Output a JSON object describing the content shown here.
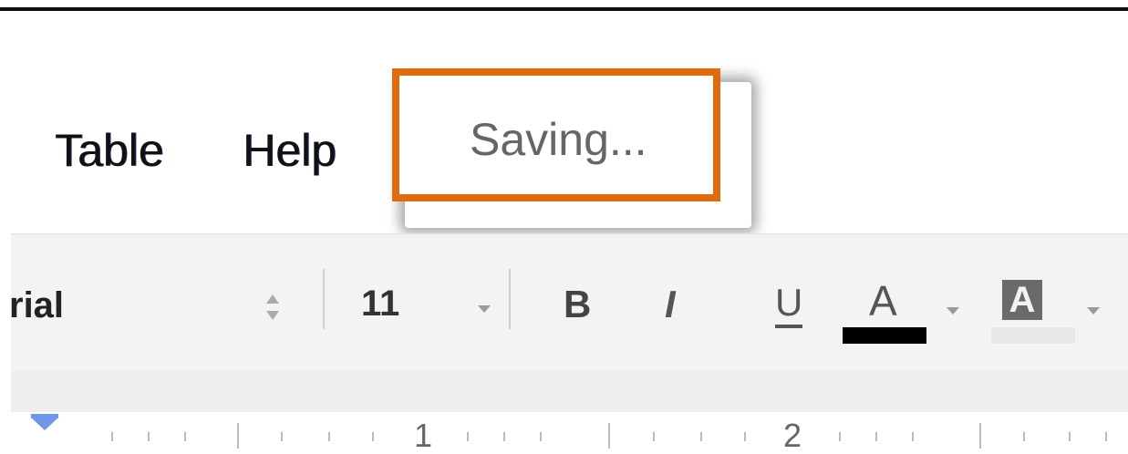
{
  "menu": {
    "table_label": "Table",
    "help_label": "Help",
    "status_text": "Saving..."
  },
  "toolbar": {
    "font_name": "rial",
    "font_size": "11",
    "bold_label": "B",
    "italic_label": "I",
    "underline_label": "U",
    "text_color_label": "A",
    "highlight_label": "A",
    "text_color_value": "#000000"
  },
  "ruler": {
    "labels": [
      "1",
      "2"
    ],
    "indent_color": "#6f97e6"
  },
  "colors": {
    "highlight_frame": "#e06a0e"
  }
}
